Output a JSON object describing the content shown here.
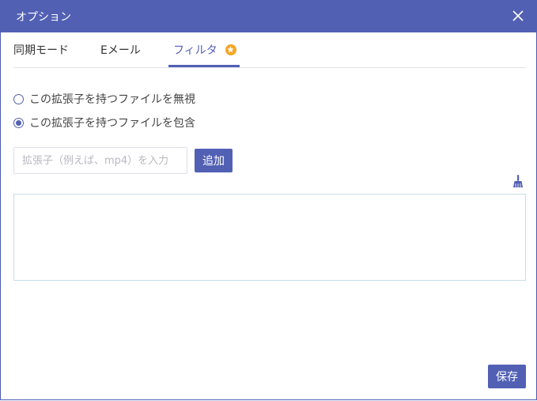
{
  "window": {
    "title": "オプション"
  },
  "tabs": [
    {
      "label": "同期モード",
      "active": false
    },
    {
      "label": "Eメール",
      "active": false
    },
    {
      "label": "フィルタ",
      "active": true,
      "badge_icon": "star-badge-icon"
    }
  ],
  "filter": {
    "options": [
      {
        "label": "この拡張子を持つファイルを無視",
        "checked": false
      },
      {
        "label": "この拡張子を持つファイルを包含",
        "checked": true
      }
    ],
    "extension_input": {
      "value": "",
      "placeholder": "拡張子（例えば、mp4）を入力"
    },
    "add_label": "追加",
    "clear_icon": "broom-icon",
    "extensions": []
  },
  "footer": {
    "save_label": "保存"
  },
  "colors": {
    "accent": "#5260b4",
    "badge": "#f5a623",
    "list_border": "#c9dfe7"
  }
}
